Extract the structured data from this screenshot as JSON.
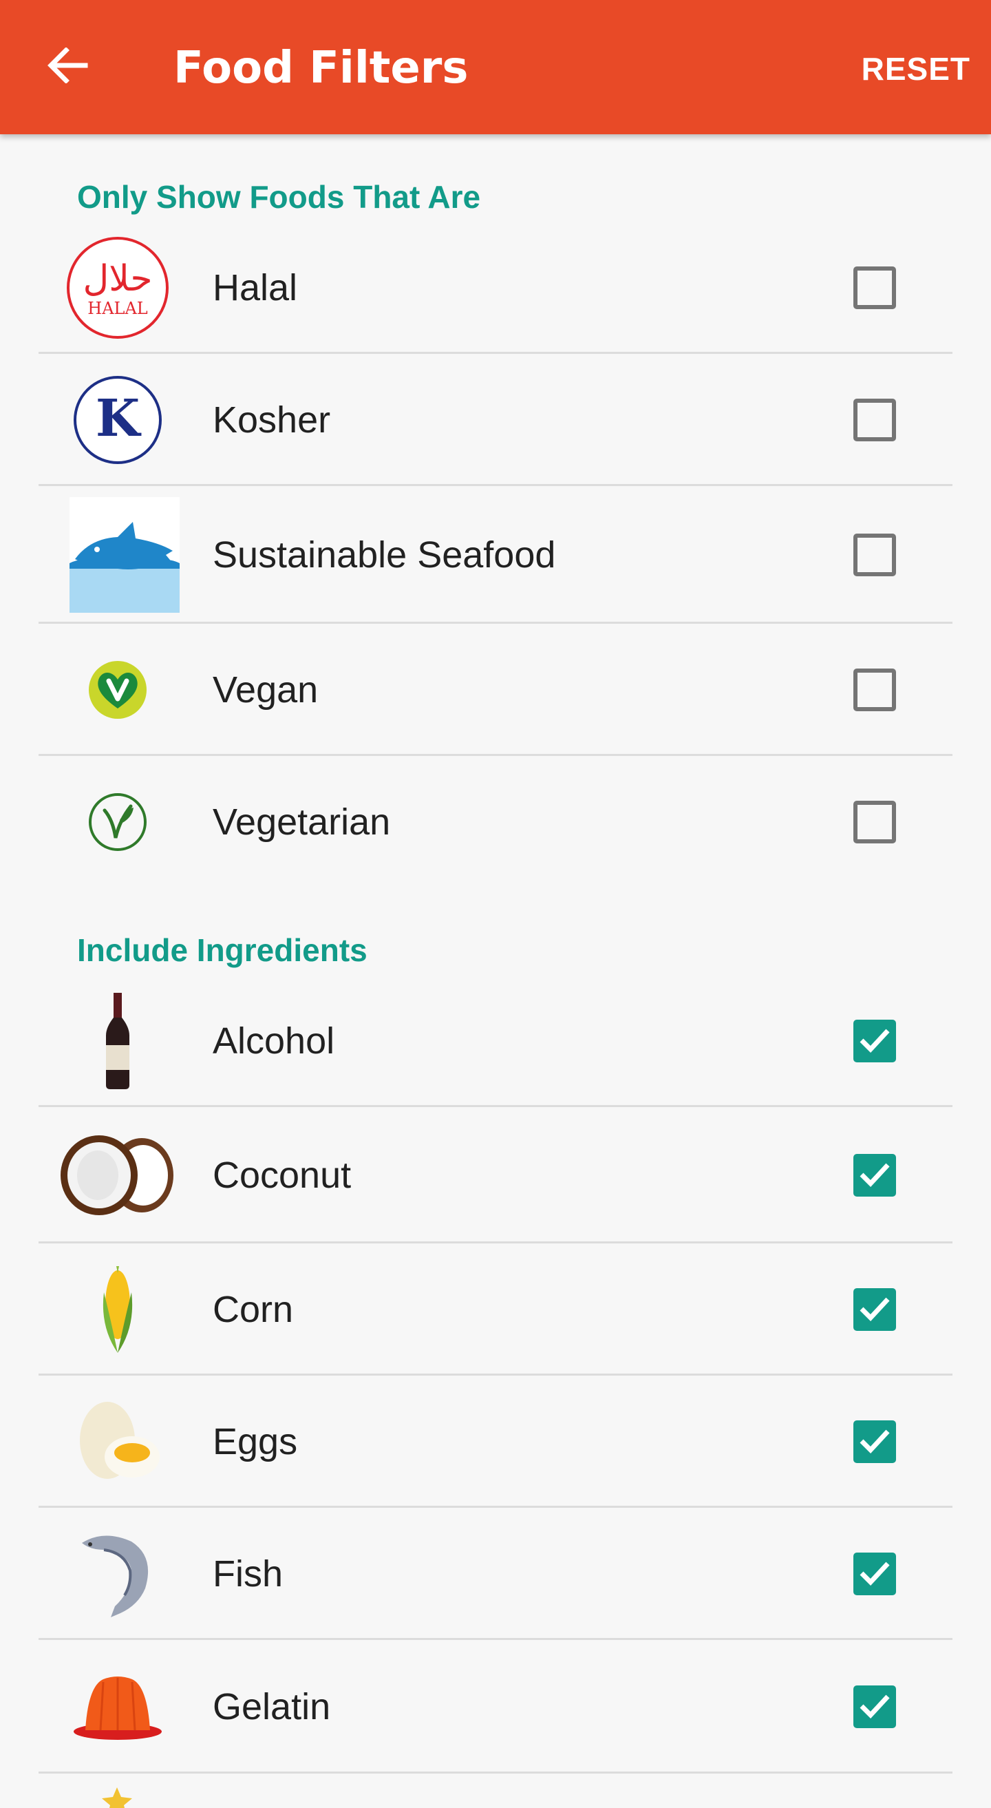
{
  "appbar": {
    "title": "Food Filters",
    "reset_label": "RESET",
    "color": "#e84a27",
    "back_icon": "arrow-left-icon"
  },
  "sections": [
    {
      "title": "Only Show Foods That Are",
      "items": [
        {
          "label": "Halal",
          "icon": "halal-icon",
          "checked": false
        },
        {
          "label": "Kosher",
          "icon": "kosher-icon",
          "checked": false
        },
        {
          "label": "Sustainable Seafood",
          "icon": "sustainable-seafood-icon",
          "checked": false
        },
        {
          "label": "Vegan",
          "icon": "vegan-icon",
          "checked": false
        },
        {
          "label": "Vegetarian",
          "icon": "vegetarian-icon",
          "checked": false
        }
      ]
    },
    {
      "title": "Include Ingredients",
      "items": [
        {
          "label": "Alcohol",
          "icon": "wine-bottle-icon",
          "checked": true
        },
        {
          "label": "Coconut",
          "icon": "coconut-icon",
          "checked": true
        },
        {
          "label": "Corn",
          "icon": "corn-icon",
          "checked": true
        },
        {
          "label": "Eggs",
          "icon": "eggs-icon",
          "checked": true
        },
        {
          "label": "Fish",
          "icon": "fish-icon",
          "checked": true
        },
        {
          "label": "Gelatin",
          "icon": "gelatin-icon",
          "checked": true
        }
      ]
    }
  ],
  "halal_icon_text": {
    "arabic": "حلال",
    "latin": "HALAL"
  },
  "kosher_icon_text": "K",
  "colors": {
    "accent": "#129b89",
    "checkbox_off": "#757575",
    "divider": "#dcdcdc",
    "background": "#f7f7f7"
  }
}
